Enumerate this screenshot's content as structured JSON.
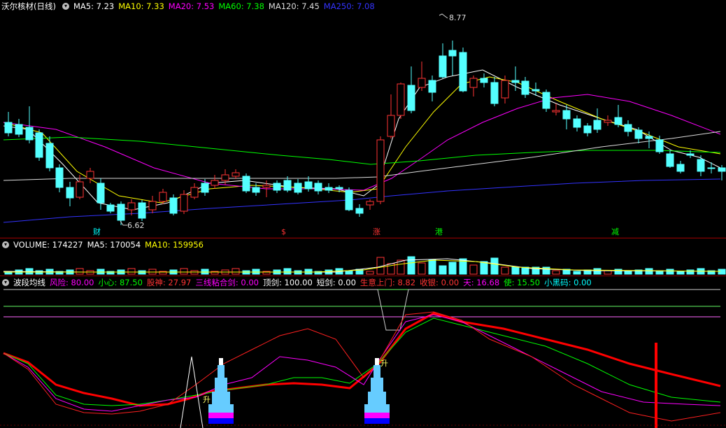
{
  "main_panel": {
    "title": "沃尔核材(日线)",
    "indicators": [
      {
        "label": "MA5: 7.23",
        "color": "#ffffff"
      },
      {
        "label": "MA10: 7.33",
        "color": "#ffff00"
      },
      {
        "label": "MA20: 7.53",
        "color": "#ff00ff"
      },
      {
        "label": "MA60: 7.38",
        "color": "#00ff00"
      },
      {
        "label": "MA120: 7.45",
        "color": "#dddddd"
      },
      {
        "label": "MA250: 7.08",
        "color": "#3333ff"
      }
    ],
    "high_label": "8.77",
    "low_label": "6.62",
    "markers": [
      {
        "text": "财",
        "color": "#00ffff"
      },
      {
        "text": "$",
        "color": "#ff3333"
      },
      {
        "text": "涨",
        "color": "#ff3333"
      },
      {
        "text": "港",
        "color": "#00ff00"
      },
      {
        "text": "减",
        "color": "#00ff00"
      }
    ]
  },
  "volume_panel": {
    "title": "VOLUME: 174227",
    "indicators": [
      {
        "label": "MA5: 170054",
        "color": "#ffffff"
      },
      {
        "label": "MA10: 159956",
        "color": "#ffff00"
      }
    ]
  },
  "indicator_panel": {
    "title": "波段均线",
    "indicators": [
      {
        "label": "风险: 80.00",
        "color": "#ff00ff"
      },
      {
        "label": "小心: 87.50",
        "color": "#00ff00"
      },
      {
        "label": "股神: 27.97",
        "color": "#ff3333"
      },
      {
        "label": "三线粘合剑: 0.00",
        "color": "#ff00ff"
      },
      {
        "label": "顶剑: 100.00",
        "color": "#ffffff"
      },
      {
        "label": "短剑: 0.00",
        "color": "#ffffff"
      },
      {
        "label": "生意上门: 8.82",
        "color": "#ff3333"
      },
      {
        "label": "收银: 0.00",
        "color": "#ff3333"
      },
      {
        "label": "天: 16.68",
        "color": "#ff00ff"
      },
      {
        "label": "使: 15.50",
        "color": "#00ff00"
      },
      {
        "label": "小黑码: 0.00",
        "color": "#00ffff"
      }
    ],
    "signal_labels": [
      "升",
      "升"
    ]
  },
  "chart_data": {
    "type": "candlestick",
    "title": "沃尔核材(日线)",
    "up_color": "#ff3333",
    "down_color": "#54ffff",
    "price_high": 8.77,
    "price_low": 6.62
  }
}
